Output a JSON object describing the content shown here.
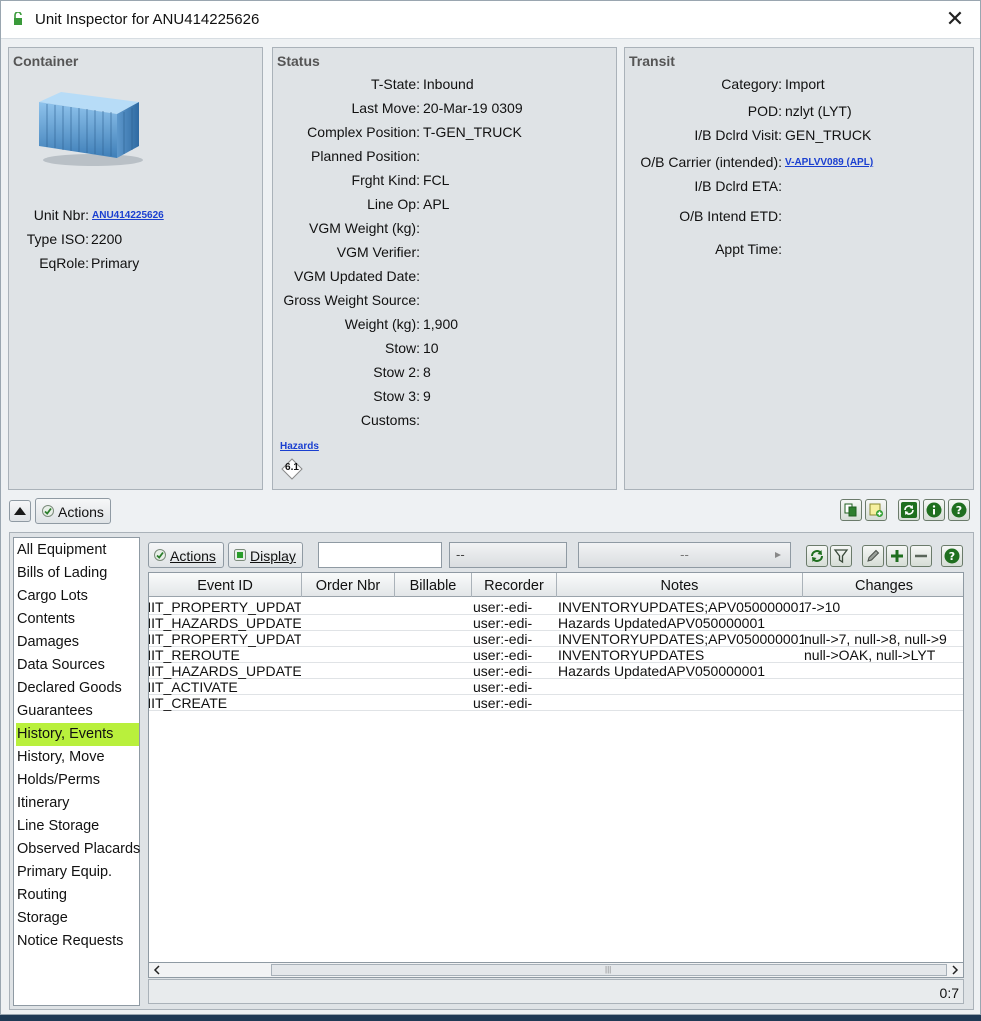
{
  "window": {
    "title": "Unit Inspector for ANU414225626",
    "close_glyph": "✕"
  },
  "container": {
    "title": "Container",
    "unit_nbr_label": "Unit Nbr:",
    "unit_nbr": "ANU414225626",
    "type_iso_label": "Type ISO:",
    "type_iso": "2200",
    "eqrole_label": "EqRole:",
    "eqrole": "Primary"
  },
  "status": {
    "title": "Status",
    "fields": [
      {
        "label": "T-State:",
        "value": "Inbound"
      },
      {
        "label": "Last Move:",
        "value": "20-Mar-19 0309"
      },
      {
        "label": "Complex Position:",
        "value": "T-GEN_TRUCK"
      },
      {
        "label": "Planned Position:",
        "value": ""
      },
      {
        "label": "Frght Kind:",
        "value": "FCL"
      },
      {
        "label": "Line Op:",
        "value": "APL"
      },
      {
        "label": "VGM Weight (kg):",
        "value": ""
      },
      {
        "label": "VGM Verifier:",
        "value": ""
      },
      {
        "label": "VGM Updated Date:",
        "value": ""
      },
      {
        "label": "Gross Weight Source:",
        "value": ""
      },
      {
        "label": "Weight (kg):",
        "value": "1,900"
      },
      {
        "label": "Stow:",
        "value": "10"
      },
      {
        "label": "Stow 2:",
        "value": "8"
      },
      {
        "label": "Stow 3:",
        "value": "9"
      },
      {
        "label": "Customs:",
        "value": ""
      }
    ],
    "hazards_link": "Hazards",
    "hazard_class": "6.1"
  },
  "transit": {
    "title": "Transit",
    "fields": [
      {
        "label": "Category:",
        "value": "Import"
      },
      {
        "label": "POD:",
        "value": "nzlyt (LYT)"
      },
      {
        "label": "I/B Dclrd Visit:",
        "value": "GEN_TRUCK"
      },
      {
        "label": "O/B Carrier (intended):",
        "value": "V-APLVV089 (APL)"
      },
      {
        "label": "I/B Dclrd ETA:",
        "value": ""
      },
      {
        "label": "O/B Intend ETD:",
        "value": ""
      },
      {
        "label": "Appt Time:",
        "value": ""
      }
    ]
  },
  "toolbar": {
    "actions_label": "Actions"
  },
  "nav": {
    "items": [
      "All Equipment",
      "Bills of Lading",
      "Cargo Lots",
      "Contents",
      "Damages",
      "Data Sources",
      "Declared Goods",
      "Guarantees",
      "History, Events",
      "History, Move",
      "Holds/Perms",
      "Itinerary",
      "Line Storage",
      "Observed Placards",
      "Primary Equip.",
      "Routing",
      "Storage",
      "Notice Requests"
    ],
    "active_index": 8
  },
  "events": {
    "actions_label": "Actions",
    "display_label": "Display",
    "search_value": "",
    "filter1": "--",
    "filter2": "--",
    "columns": [
      "Event ID",
      "Order Nbr",
      "Billable",
      "Recorder",
      "Notes",
      "Changes"
    ],
    "rows": [
      [
        "NIT_PROPERTY_UPDATE",
        "",
        "",
        "user:-edi-",
        "INVENTORYUPDATES;APV050000001",
        "7->10"
      ],
      [
        "NIT_HAZARDS_UPDATE",
        "",
        "",
        "user:-edi-",
        "Hazards UpdatedAPV050000001",
        ""
      ],
      [
        "NIT_PROPERTY_UPDATE",
        "",
        "",
        "user:-edi-",
        "INVENTORYUPDATES;APV050000001",
        "null->7, null->8, null->9"
      ],
      [
        "NIT_REROUTE",
        "",
        "",
        "user:-edi-",
        "INVENTORYUPDATES",
        "null->OAK, null->LYT"
      ],
      [
        "NIT_HAZARDS_UPDATE",
        "",
        "",
        "user:-edi-",
        "Hazards UpdatedAPV050000001",
        ""
      ],
      [
        "NIT_ACTIVATE",
        "",
        "",
        "user:-edi-",
        "",
        ""
      ],
      [
        "NIT_CREATE",
        "",
        "",
        "user:-edi-",
        "",
        ""
      ]
    ],
    "count": "0:7"
  },
  "icons": {
    "container": "container-icon",
    "refresh": "refresh-icon",
    "filter": "filter-icon",
    "edit": "pencil-icon",
    "add": "plus-icon",
    "remove": "minus-icon",
    "help": "help-icon",
    "info": "info-icon"
  },
  "colors": {
    "active_nav": "#b9f03c",
    "link": "#1a3fd0"
  }
}
